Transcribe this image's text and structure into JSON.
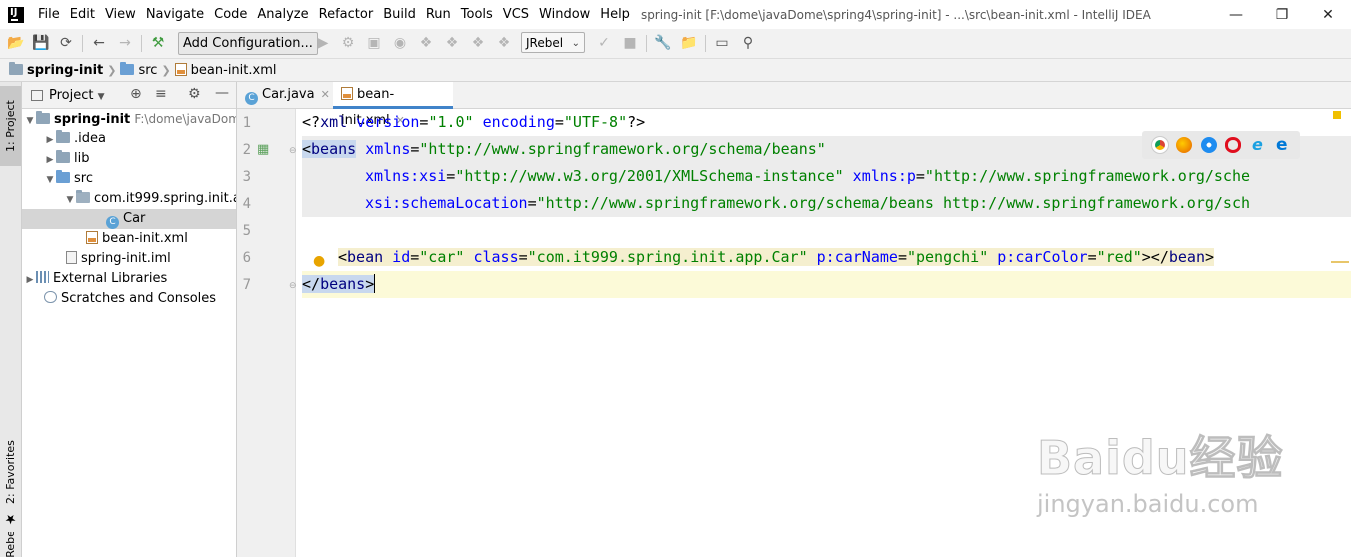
{
  "menubar": {
    "items": [
      "File",
      "Edit",
      "View",
      "Navigate",
      "Code",
      "Analyze",
      "Refactor",
      "Build",
      "Run",
      "Tools",
      "VCS",
      "Window",
      "Help"
    ],
    "title": "spring-init [F:\\dome\\javaDome\\spring4\\spring-init] - ...\\src\\bean-init.xml - IntelliJ IDEA"
  },
  "toolbar": {
    "add_configuration": "Add Configuration...",
    "jrebel": "JRebel"
  },
  "breadcrumb": [
    "spring-init",
    "src",
    "bean-init.xml"
  ],
  "left_strip": {
    "project_tab": "1: Project",
    "favorites_tab": "2: Favorites",
    "jrebel_tab": "JRebel"
  },
  "project_panel": {
    "title": "Project",
    "tree": [
      {
        "label": "spring-init",
        "path": "F:\\dome\\javaDom",
        "bold": true
      },
      {
        "label": ".idea"
      },
      {
        "label": "lib"
      },
      {
        "label": "src"
      },
      {
        "label": "com.it999.spring.init.app"
      },
      {
        "label": "Car"
      },
      {
        "label": "bean-init.xml"
      },
      {
        "label": "spring-init.iml"
      },
      {
        "label": "External Libraries"
      },
      {
        "label": "Scratches and Consoles"
      }
    ]
  },
  "editor": {
    "tabs": [
      "Car.java",
      "bean-init.xml"
    ],
    "line_numbers": [
      "1",
      "2",
      "3",
      "4",
      "5",
      "6",
      "7"
    ],
    "lines": {
      "l1": {
        "a": "<?",
        "b": "xml",
        "c": " version",
        "d": "=",
        "e": "\"1.0\"",
        "f": " encoding",
        "g": "=",
        "h": "\"UTF-8\"",
        "i": "?>"
      },
      "l2": {
        "a": "<",
        "b": "beans",
        "c": " xmlns",
        "d": "=",
        "e": "\"http://www.springframework.org/schema/beans\""
      },
      "l3": {
        "a": "xmlns:xsi",
        "b": "=",
        "c": "\"http://www.w3.org/2001/XMLSchema-instance\"",
        "d": " xmlns:p",
        "e": "=",
        "f": "\"http://www.springframework.org/sche"
      },
      "l4": {
        "a": "xsi:schemaLocation",
        "b": "=",
        "c": "\"http://www.springframework.org/schema/beans http://www.springframework.org/sch"
      },
      "l6": {
        "a": "<",
        "b": "bean",
        "c": " id",
        "d": "=",
        "e": "\"car\"",
        "f": " class",
        "g": "=",
        "h": "\"com.it999.spring.init.app.Car\"",
        "i": " p:carName",
        "j": "=",
        "k": "\"pengchi\"",
        "l": " p:carColor",
        "m": "=",
        "n": "\"red\"",
        "o": "></",
        "p": "bean",
        "q": ">"
      },
      "l7": {
        "a": "</",
        "b": "beans",
        "c": ">"
      }
    }
  },
  "browser_icons": [
    "chrome-icon",
    "firefox-icon",
    "safari-icon",
    "opera-icon",
    "ie-icon",
    "edge-icon"
  ],
  "watermark": {
    "brand": "Baidu经验",
    "url": "jingyan.baidu.com"
  }
}
